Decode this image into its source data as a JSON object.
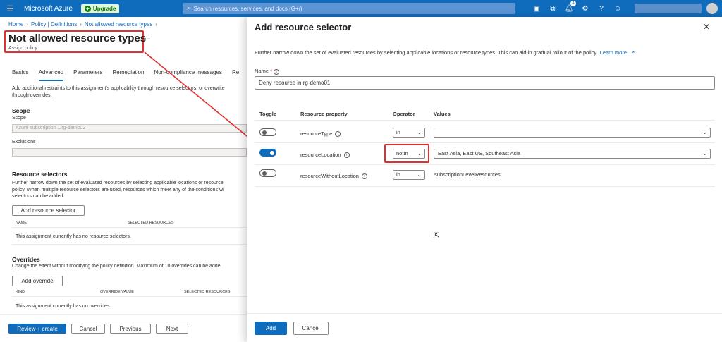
{
  "topbar": {
    "brand": "Microsoft Azure",
    "upgrade_label": "Upgrade",
    "search_placeholder": "Search resources, services, and docs (G+/)",
    "notification_count": "4"
  },
  "breadcrumb": [
    "Home",
    "Policy | Definitions",
    "Not allowed resource types"
  ],
  "page": {
    "title": "Not allowed resource types",
    "subtitle": "Assign policy",
    "ellipsis": "..."
  },
  "tabs": [
    "Basics",
    "Advanced",
    "Parameters",
    "Remediation",
    "Non-compliance messages",
    "Re"
  ],
  "advanced": {
    "description": "Add additional restraints to this assignment's applicability through resource selectors, or overwrite",
    "description2": "through overrides.",
    "scope_heading": "Scope",
    "scope_label": "Scope",
    "scope_value": "Azure subscription 1/rg-demo02",
    "exclusions_label": "Exclusions",
    "exclusions_value": "",
    "selectors_heading": "Resource selectors",
    "selectors_desc": [
      "Further narrow down the set of evaluated resources by selecting applicable locations or resource",
      "policy. When multiple resource selectors are used, resources which meet any of the conditions wi",
      "selectors can be added."
    ],
    "add_selector_label": "Add resource selector",
    "selectors_columns": [
      "NAME",
      "SELECTED RESOURCES"
    ],
    "selectors_empty": "This assignment currently has no resource selectors.",
    "overrides_heading": "Overrides",
    "overrides_desc": "Change the effect without modifying the policy definition. Maximum of 10 overrides can be adde",
    "add_override_label": "Add override",
    "overrides_columns": [
      "KIND",
      "OVERRIDE VALUE",
      "SELECTED RESOURCES"
    ],
    "overrides_empty": "This assignment currently has no overrides."
  },
  "footer_left": {
    "review_create": "Review + create",
    "cancel": "Cancel",
    "previous": "Previous",
    "next": "Next"
  },
  "panel": {
    "title": "Add resource selector",
    "close": "✕",
    "description": "Further narrow down the set of evaluated resources by selecting applicable locations or resource types. This can aid in gradual rollout of the policy.",
    "learn_more": "Learn more",
    "name_label": "Name",
    "name_required": "*",
    "name_value": "Deny resource in rg-demo01",
    "columns": [
      "Toggle",
      "Resource property",
      "Operator",
      "Values"
    ],
    "rows": [
      {
        "property": "resourceType",
        "operator": "in",
        "value": "",
        "toggle": "off"
      },
      {
        "property": "resourceLocation",
        "operator": "notIn",
        "value": "East Asia, East US, Southeast Asia",
        "toggle": "on"
      },
      {
        "property": "resourceWithoutLocation",
        "operator": "in",
        "value": "subscriptionLevelResources",
        "toggle": "off"
      }
    ],
    "add_label": "Add",
    "cancel_label": "Cancel"
  },
  "colors": {
    "azure_blue": "#0f6cbd",
    "highlight_red": "#e03030"
  }
}
